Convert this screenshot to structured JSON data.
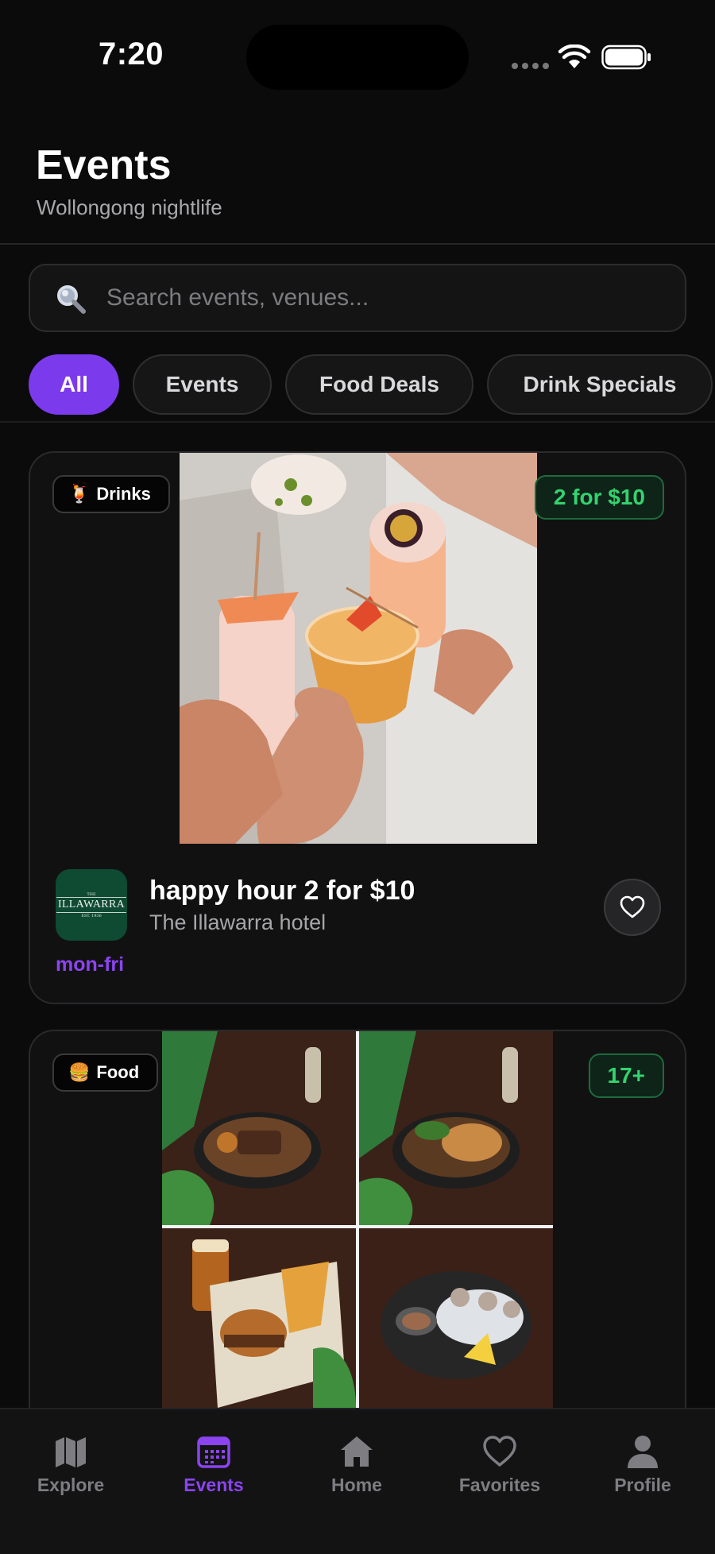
{
  "status_bar": {
    "time": "7:20"
  },
  "header": {
    "title": "Events",
    "subtitle": "Wollongong nightlife"
  },
  "search": {
    "placeholder": "Search events, venues..."
  },
  "filters": [
    {
      "label": "All",
      "active": true
    },
    {
      "label": "Events",
      "active": false
    },
    {
      "label": "Food Deals",
      "active": false
    },
    {
      "label": "Drink Specials",
      "active": false
    }
  ],
  "cards": [
    {
      "category_emoji": "🍹",
      "category": "Drinks",
      "badge": "2 for $10",
      "title": "happy hour 2 for $10",
      "venue": "The Illawarra hotel",
      "schedule": "mon-fri",
      "logo": {
        "top": "THE",
        "main": "ILLAWARRA",
        "sub": "EST. 1936"
      }
    },
    {
      "category_emoji": "🍔",
      "category": "Food",
      "badge": "17+"
    }
  ],
  "tabs": [
    {
      "label": "Explore",
      "icon": "map-icon",
      "active": false
    },
    {
      "label": "Events",
      "icon": "calendar-icon",
      "active": true
    },
    {
      "label": "Home",
      "icon": "home-icon",
      "active": false
    },
    {
      "label": "Favorites",
      "icon": "heart-icon",
      "active": false
    },
    {
      "label": "Profile",
      "icon": "person-icon",
      "active": false
    }
  ],
  "colors": {
    "accent": "#7c3aed",
    "accent_text": "#8b44f0",
    "badge_green": "#34d36f",
    "background": "#0b0b0c"
  }
}
